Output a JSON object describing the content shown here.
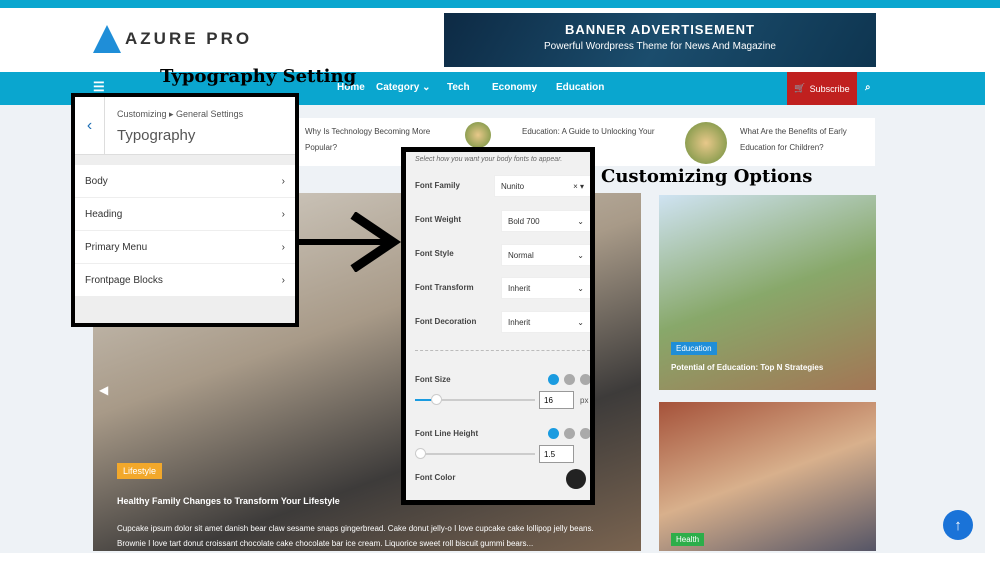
{
  "site": {
    "logo": "AZURE PRO",
    "banner_title": "BANNER ADVERTISEMENT",
    "banner_subtitle": "Powerful Wordpress Theme for News And Magazine"
  },
  "nav": {
    "items": [
      "Home",
      "Category",
      "Tech",
      "Economy",
      "Education"
    ],
    "subscribe": "Subscribe"
  },
  "ticker": [
    {
      "title": "Why Is Technology Becoming More Popular?"
    },
    {
      "title": "Education: A Guide to Unlocking Your"
    },
    {
      "title": "What Are the Benefits of Early Education for Children?"
    }
  ],
  "slider": {
    "category": "Lifestyle",
    "title": "Healthy Family Changes to Transform Your Lifestyle",
    "excerpt": "Cupcake ipsum dolor sit amet danish bear claw sesame snaps gingerbread. Cake donut jelly-o I love cupcake cake lollipop jelly beans. Brownie I love tart donut croissant chocolate cake chocolate bar ice cream. Liquorice sweet roll biscuit gummi bears..."
  },
  "cards": [
    {
      "category": "Education",
      "title": "Potential of Education: Top N Strategies"
    },
    {
      "category": "Health"
    }
  ],
  "annotations": {
    "left": "Typography Setting",
    "right": "Customizing Options"
  },
  "customizer": {
    "breadcrumb": "Customizing ▸ General Settings",
    "title": "Typography",
    "items": [
      "Body",
      "Heading",
      "Primary Menu",
      "Frontpage Blocks"
    ]
  },
  "options": {
    "hint": "Select how you want your body fonts to appear.",
    "font_family": {
      "label": "Font Family",
      "value": "Nunito"
    },
    "font_weight": {
      "label": "Font Weight",
      "value": "Bold 700"
    },
    "font_style": {
      "label": "Font Style",
      "value": "Normal"
    },
    "font_transform": {
      "label": "Font Transform",
      "value": "Inherit"
    },
    "font_decoration": {
      "label": "Font Decoration",
      "value": "Inherit"
    },
    "font_size": {
      "label": "Font Size",
      "value": "16",
      "unit": "px"
    },
    "line_height": {
      "label": "Font Line Height",
      "value": "1.5"
    },
    "font_color": {
      "label": "Font Color",
      "value": "#222222"
    }
  },
  "colors": {
    "accent": "#0aa6cf",
    "subscribe": "#c0201f"
  }
}
